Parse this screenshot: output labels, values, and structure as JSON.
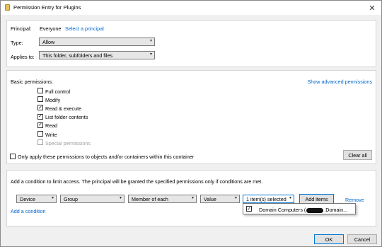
{
  "window": {
    "title": "Permission Entry for Plugins",
    "close_glyph": "✕"
  },
  "principal": {
    "label": "Principal:",
    "value": "Everyone",
    "link": "Select a principal"
  },
  "type": {
    "label": "Type:",
    "value": "Allow"
  },
  "applies_to": {
    "label": "Applies to:",
    "value": "This folder, subfolders and files"
  },
  "basic_permissions": {
    "label": "Basic permissions:",
    "advanced_link": "Show advanced permissions",
    "items": [
      {
        "label": "Full control",
        "checked": false,
        "disabled": false
      },
      {
        "label": "Modify",
        "checked": false,
        "disabled": false
      },
      {
        "label": "Read & execute",
        "checked": true,
        "disabled": false
      },
      {
        "label": "List folder contents",
        "checked": true,
        "disabled": false
      },
      {
        "label": "Read",
        "checked": true,
        "disabled": false
      },
      {
        "label": "Write",
        "checked": false,
        "disabled": false
      },
      {
        "label": "Special permissions",
        "checked": false,
        "disabled": true
      }
    ],
    "only_apply_label": "Only apply these permissions to objects and/or containers within this container",
    "clear_all": "Clear all"
  },
  "condition": {
    "description": "Add a condition to limit access. The principal will be granted the specified permissions only if conditions are met.",
    "selects": [
      "Device",
      "Group",
      "Member of each",
      "Value",
      "1 item(s) selected"
    ],
    "add_items": "Add items",
    "remove": "Remove",
    "add_condition": "Add a condition",
    "popup_item": {
      "checked": true,
      "prefix": "Domain Computers (",
      "suffix": ".Domain..."
    }
  },
  "footer": {
    "ok": "OK",
    "cancel": "Cancel"
  },
  "colors": {
    "link": "#0066cc",
    "focus_border": "#0078d7"
  }
}
